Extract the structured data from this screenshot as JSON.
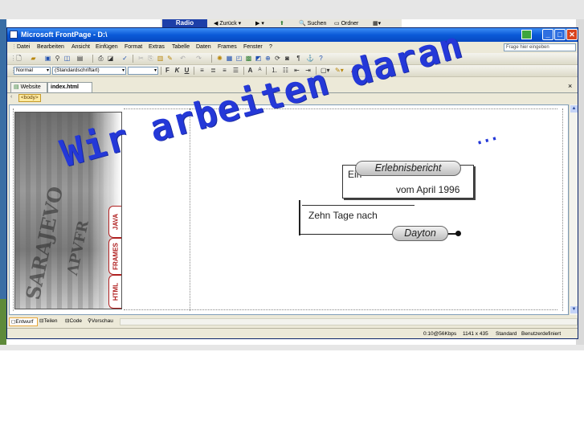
{
  "background_window": {
    "radio_label": "Radio",
    "back_label": "Zurück",
    "search_label": "Suchen",
    "folders_label": "Ordner"
  },
  "window": {
    "title": "Microsoft FrontPage - D:\\",
    "controls": {
      "minimize": "_",
      "maximize": "□",
      "close": "✕"
    }
  },
  "menu": {
    "items": [
      "Datei",
      "Bearbeiten",
      "Ansicht",
      "Einfügen",
      "Format",
      "Extras",
      "Tabelle",
      "Daten",
      "Frames",
      "Fenster",
      "?"
    ],
    "help_placeholder": "Frage hier eingeben"
  },
  "format_bar": {
    "style_value": "Normal",
    "font_value": "(Standardschriftart)",
    "size_value": "",
    "bold": "F",
    "italic": "K",
    "underline": "U"
  },
  "document_tabs": {
    "tabs": [
      "Website",
      "index.html"
    ],
    "active": "index.html",
    "close": "×"
  },
  "tag_selector": {
    "tag": "<body>"
  },
  "page_content": {
    "side_tabs": [
      "JAVA",
      "FRAMES",
      "HTML"
    ],
    "box1_line1_prefix": "Ein",
    "box1_pill": "Erlebnisbericht",
    "box1_line2": "vom April 1996",
    "box2_line1": "Zehn Tage nach",
    "box2_pill": "Dayton"
  },
  "overlay": {
    "text": "Wir arbeiten daran",
    "dots": "..."
  },
  "view_tabs": [
    "Entwurf",
    "Teilen",
    "Code",
    "Vorschau"
  ],
  "active_view": "Entwurf",
  "status_bar": {
    "speed": "0:10@56Kbps",
    "dimensions": "1141 x 435",
    "mode": "Standard",
    "custom": "Benutzerdefiniert"
  }
}
